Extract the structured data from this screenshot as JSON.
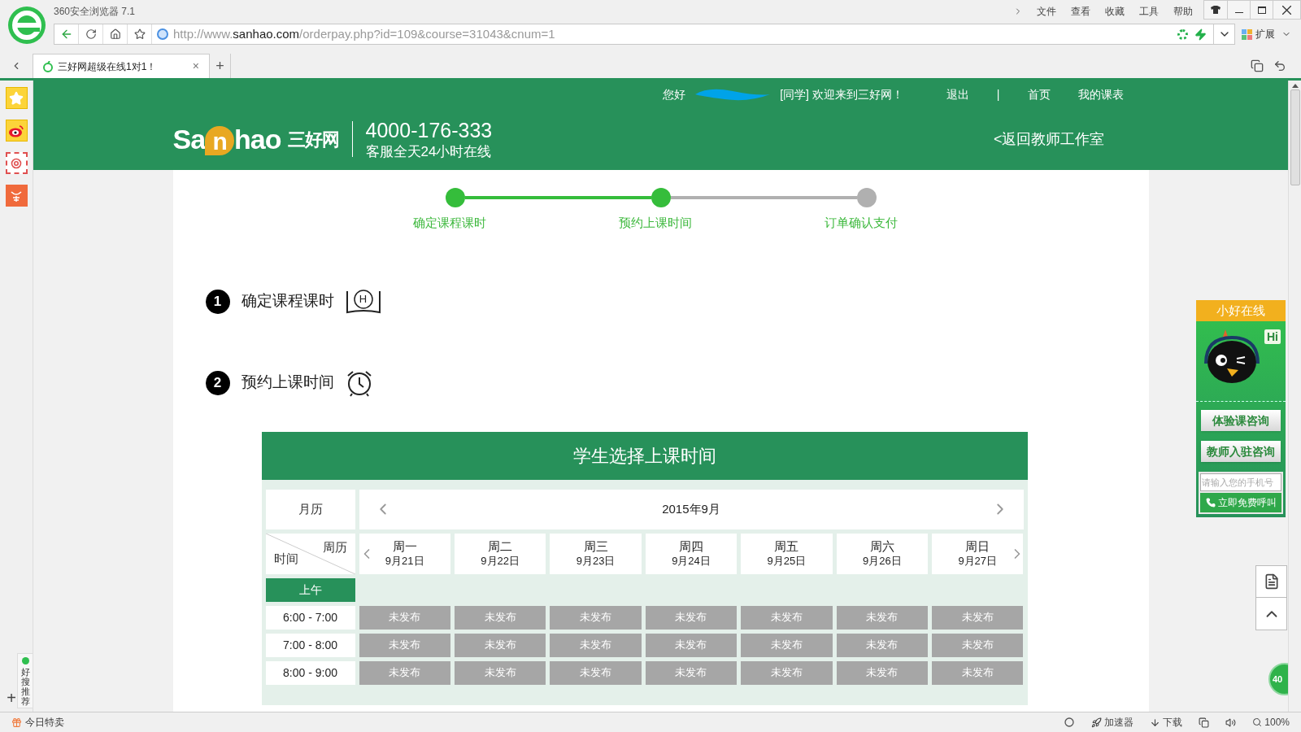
{
  "browser": {
    "title": "360安全浏览器 7.1",
    "menu": [
      "文件",
      "查看",
      "收藏",
      "工具",
      "帮助"
    ],
    "url_prefix": "http://www.",
    "url_domain": "sanhao.com",
    "url_path": "/orderpay.php?id=109&course=31043&cnum=1",
    "extension_label": "扩展",
    "tab": {
      "title": "三好网超级在线1对1！",
      "close": "×"
    },
    "new_tab": "+"
  },
  "left_sidebar": {
    "recommend_label": "好搜推荐",
    "add": "+"
  },
  "header": {
    "greeting": "您好",
    "welcome": "[同学] 欢迎来到三好网！",
    "links": [
      "退出",
      "|",
      "首页",
      "我的课表"
    ],
    "logo_a": "Sa",
    "logo_n": "n",
    "logo_b": "hao",
    "logo_cn": "三好网",
    "phone": "4000-176-333",
    "service": "客服全天24小时在线",
    "back_link": "<返回教师工作室"
  },
  "steps": [
    {
      "label": "确定课程课时",
      "done": true
    },
    {
      "label": "预约上课时间",
      "done": true
    },
    {
      "label": "订单确认支付",
      "done": false
    }
  ],
  "sections": [
    {
      "number": "1",
      "title": "确定课程课时",
      "kind": "book",
      "icon_letter": "H"
    },
    {
      "number": "2",
      "title": "预约上课时间",
      "kind": "alarm"
    }
  ],
  "schedule": {
    "title": "学生选择上课时间",
    "calendar_label": "月历",
    "month": "2015年9月",
    "corner_top": "周历",
    "corner_bottom": "时间",
    "days": [
      {
        "weekday": "周一",
        "date": "9月21日"
      },
      {
        "weekday": "周二",
        "date": "9月22日"
      },
      {
        "weekday": "周三",
        "date": "9月23日"
      },
      {
        "weekday": "周四",
        "date": "9月24日"
      },
      {
        "weekday": "周五",
        "date": "9月25日"
      },
      {
        "weekday": "周六",
        "date": "9月26日"
      },
      {
        "weekday": "周日",
        "date": "9月27日"
      }
    ],
    "period": "上午",
    "rows": [
      {
        "time": "6:00 - 7:00",
        "slots": [
          "未发布",
          "未发布",
          "未发布",
          "未发布",
          "未发布",
          "未发布",
          "未发布"
        ]
      },
      {
        "time": "7:00 - 8:00",
        "slots": [
          "未发布",
          "未发布",
          "未发布",
          "未发布",
          "未发布",
          "未发布",
          "未发布"
        ]
      },
      {
        "time": "8:00 - 9:00",
        "slots": [
          "未发布",
          "未发布",
          "未发布",
          "未发布",
          "未发布",
          "未发布",
          "未发布"
        ]
      }
    ]
  },
  "chat_widget": {
    "title": "小好在线",
    "hi": "Hi",
    "buttons": [
      "体验课咨询",
      "教师入驻咨询"
    ],
    "phone_placeholder": "请输入您的手机号",
    "call_button": "立即免费呼叫"
  },
  "float_badge": "40",
  "status_bar": {
    "left": "今日特卖",
    "items": [
      "加速器",
      "下载"
    ],
    "zoom": "100%"
  }
}
